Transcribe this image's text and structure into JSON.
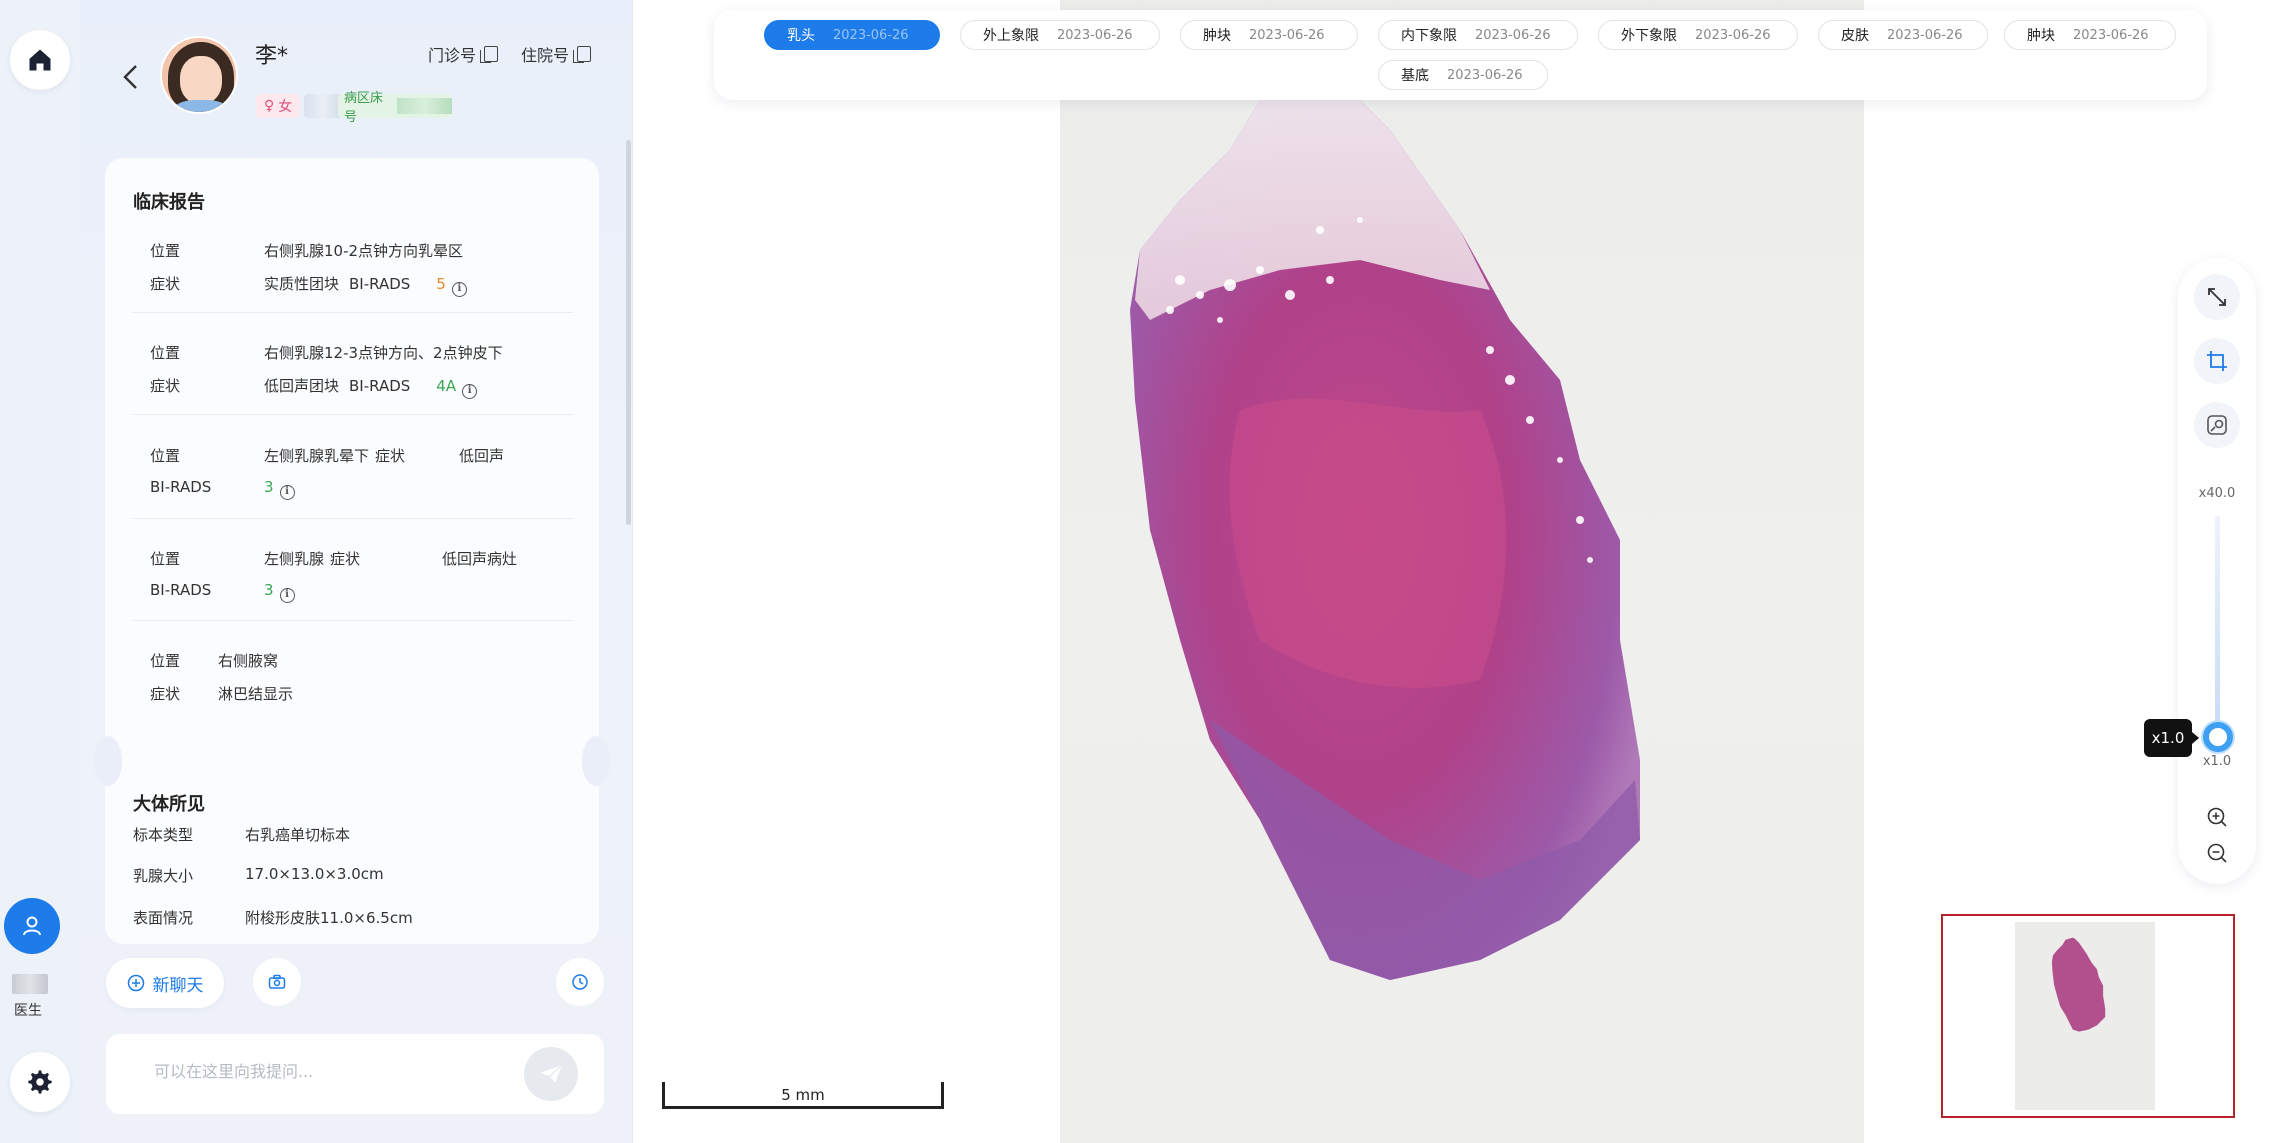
{
  "rail": {
    "user_role": "医生"
  },
  "patient": {
    "name": "李*",
    "gender": "女",
    "clinic_no_label": "门诊号",
    "hosp_no_label": "住院号",
    "ward_label": "病区床号"
  },
  "report": {
    "title": "临床报告",
    "findings": [
      {
        "pos_label": "位置",
        "pos": "右侧乳腺10-2点钟方向乳晕区",
        "sym_label": "症状",
        "sym": "实质性团块",
        "bi_label": "BI-RADS",
        "bi": "5",
        "bi_color": "#e38a2e"
      },
      {
        "pos_label": "位置",
        "pos": "右侧乳腺12-3点钟方向、2点钟皮下",
        "sym_label": "症状",
        "sym": "低回声团块",
        "bi_label": "BI-RADS",
        "bi": "4A",
        "bi_color": "#3aa655"
      },
      {
        "pos_label": "位置",
        "pos": "左侧乳腺乳晕下",
        "sym_label": "症状",
        "sym": "低回声",
        "bi_label": "BI-RADS",
        "bi": "3",
        "bi_color": "#3aa655"
      },
      {
        "pos_label": "位置",
        "pos": "左侧乳腺",
        "sym_label": "症状",
        "sym": "低回声病灶",
        "bi_label": "BI-RADS",
        "bi": "3",
        "bi_color": "#3aa655"
      },
      {
        "pos_label": "位置",
        "pos": "右侧腋窝",
        "sym_label": "症状",
        "sym": "淋巴结显示"
      }
    ],
    "gross_title": "大体所见",
    "gross": [
      {
        "label": "标本类型",
        "value": "右乳癌单切标本"
      },
      {
        "label": "乳腺大小",
        "value": "17.0×13.0×3.0cm"
      },
      {
        "label": "表面情况",
        "value": "附梭形皮肤11.0×6.5cm"
      }
    ]
  },
  "chat": {
    "new_chat_label": "新聊天",
    "input_placeholder": "可以在这里向我提问..."
  },
  "tabs": [
    {
      "label": "乳头",
      "date": "2023-06-26",
      "active": true
    },
    {
      "label": "外上象限",
      "date": "2023-06-26"
    },
    {
      "label": "肿块",
      "date": "2023-06-26"
    },
    {
      "label": "内下象限",
      "date": "2023-06-26"
    },
    {
      "label": "外下象限",
      "date": "2023-06-26"
    },
    {
      "label": "皮肤",
      "date": "2023-06-26"
    },
    {
      "label": "肿块",
      "date": "2023-06-26"
    },
    {
      "label": "基底",
      "date": "2023-06-26"
    }
  ],
  "viewer": {
    "zoom_max": "x40.0",
    "zoom_min": "x1.0",
    "zoom_current": "x1.0",
    "scale_label": "5 mm",
    "accent": "#1d7bea",
    "minimap_border": "#b8222b"
  }
}
